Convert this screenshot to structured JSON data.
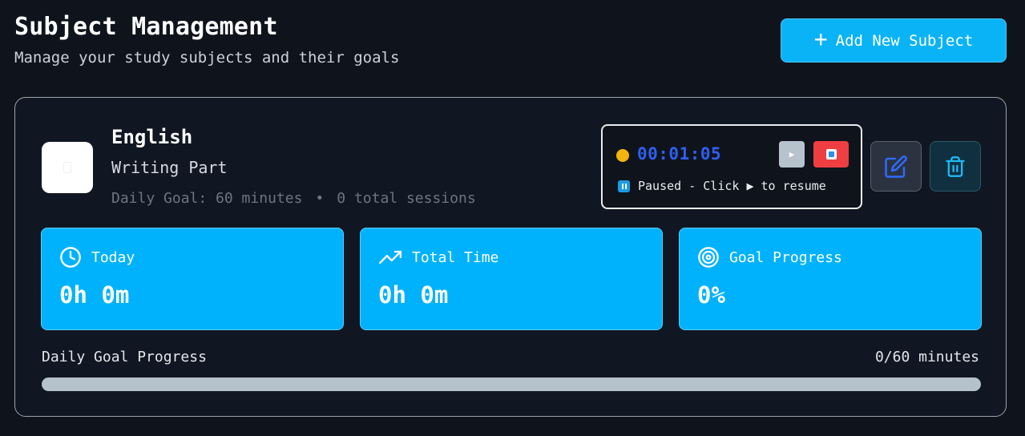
{
  "header": {
    "title": "Subject Management",
    "subtitle": "Manage your study subjects and their goals",
    "add_button_label": "Add New Subject"
  },
  "subject": {
    "name": "English",
    "description": "Writing Part",
    "daily_goal_text": "Daily Goal: 60 minutes",
    "separator": "•",
    "sessions_text": "0 total sessions"
  },
  "timer": {
    "time": "00:01:05",
    "play_symbol": "▶",
    "status_text": "Paused - Click ▶ to resume",
    "state_color": "#f3b40f"
  },
  "stats": [
    {
      "label": "Today",
      "value": "0h 0m",
      "icon": "clock-icon"
    },
    {
      "label": "Total Time",
      "value": "0h 0m",
      "icon": "trending-up-icon"
    },
    {
      "label": "Goal Progress",
      "value": "0%",
      "icon": "target-icon"
    }
  ],
  "progress": {
    "label": "Daily Goal Progress",
    "count_text": "0/60 minutes",
    "fraction": 0
  },
  "colors": {
    "accent": "#00b2fb",
    "background": "#0f141c",
    "stop": "#ef3e42",
    "timer_text": "#2f5ff0"
  }
}
